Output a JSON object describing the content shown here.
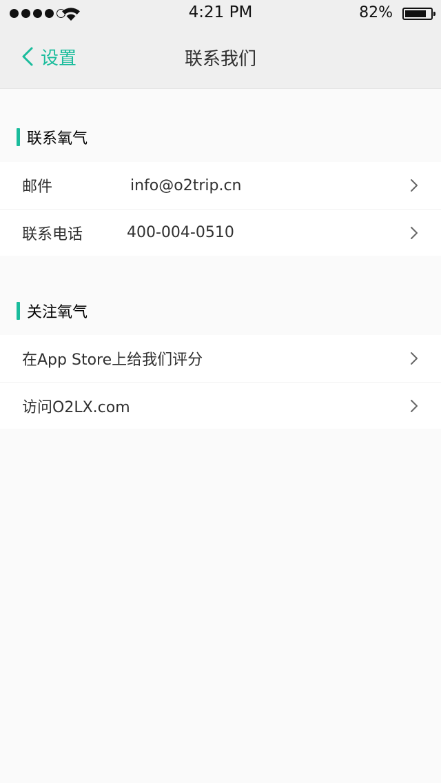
{
  "status_bar": {
    "time": "4:21 PM",
    "battery_percent": "82%",
    "battery_level": 0.82,
    "signal_bars": 5,
    "signal_filled": 4
  },
  "nav": {
    "back_label": "设置",
    "title": "联系我们"
  },
  "sections": [
    {
      "title": "联系氧气",
      "rows": [
        {
          "label": "邮件",
          "value": "info@o2trip.cn"
        },
        {
          "label": "联系电话",
          "value": "400-004-0510"
        }
      ]
    },
    {
      "title": "关注氧气",
      "rows": [
        {
          "label": "在App Store上给我们评分",
          "value": ""
        },
        {
          "label": "访问O2LX.com",
          "value": ""
        }
      ]
    }
  ],
  "icons": {
    "back": "chevron-left-icon",
    "row_arrow": "chevron-right-icon",
    "wifi": "wifi-icon",
    "battery": "battery-icon"
  },
  "colors": {
    "accent": "#1abc9c",
    "text": "#303030",
    "section_text": "#000000",
    "divider_nav": "#e5e5e5",
    "divider_row": "#f0f0f0",
    "row_bg": "#ffffff",
    "page_bg": "#fafafa"
  }
}
